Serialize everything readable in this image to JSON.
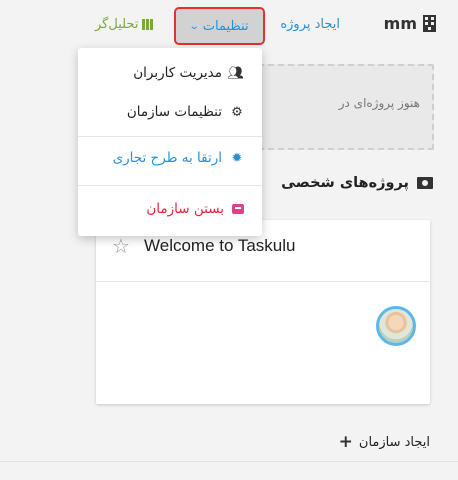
{
  "header": {
    "brand": "mm",
    "create_project": "ایجاد پروژه",
    "settings": "تنظیمات",
    "analyst": "تحلیل‌گر"
  },
  "empty_projects": "هنوز پروژه‌ای در",
  "section": {
    "title": "پروژه‌های شخصی"
  },
  "card": {
    "title": "Welcome to Taskulu"
  },
  "create_org": "ایجاد سازمان",
  "menu": {
    "users": "مدیریت کاربران",
    "org_settings": "تنظیمات سازمان",
    "upgrade": "ارتقا به طرح تجاری",
    "close_org": "بستن سازمان"
  },
  "colors": {
    "accent_blue": "#2b8fd8",
    "analyst_green": "#7aa93a",
    "danger_red": "#e0263a",
    "highlight_outline": "#e3312b"
  },
  "icons": {
    "brand": "building-icon",
    "analyst": "books-icon",
    "section": "folder-user-icon",
    "card": "star-icon",
    "users": "users-icon",
    "org_settings": "gears-icon",
    "upgrade": "badge-icon",
    "close_org": "archive-box-icon",
    "create_org": "plus-icon"
  }
}
